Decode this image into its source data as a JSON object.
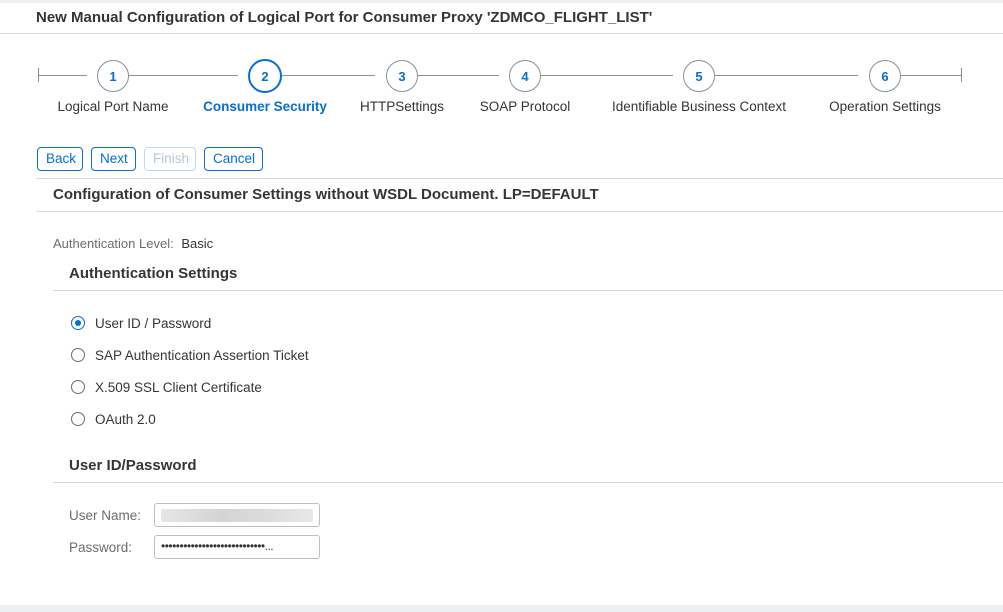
{
  "window": {
    "title": "New Manual Configuration of Logical Port for Consumer Proxy 'ZDMCO_FLIGHT_LIST'"
  },
  "wizard": {
    "active_step": 2,
    "steps": [
      {
        "number": "1",
        "label": "Logical Port Name"
      },
      {
        "number": "2",
        "label": "Consumer Security"
      },
      {
        "number": "3",
        "label": "HTTPSettings"
      },
      {
        "number": "4",
        "label": "SOAP Protocol"
      },
      {
        "number": "5",
        "label": "Identifiable Business Context"
      },
      {
        "number": "6",
        "label": "Operation Settings"
      }
    ]
  },
  "toolbar": {
    "back_label": "Back",
    "next_label": "Next",
    "finish_label": "Finish",
    "cancel_label": "Cancel"
  },
  "section": {
    "title": "Configuration of Consumer Settings without WSDL Document. LP=DEFAULT"
  },
  "auth_level": {
    "label": "Authentication Level:",
    "value": "Basic"
  },
  "auth_settings": {
    "title": "Authentication Settings",
    "selected": "User ID / Password",
    "options": [
      "User ID / Password",
      "SAP Authentication Assertion Ticket",
      "X.509 SSL Client Certificate",
      "OAuth 2.0"
    ]
  },
  "credentials": {
    "title": "User ID/Password",
    "username_label": "User Name:",
    "password_label": "Password:",
    "password_value": "••••••••••••••••••••••••••••..."
  },
  "colors": {
    "accent": "#0a6ed1",
    "text": "#32363a",
    "muted": "#6a6d70",
    "border": "#d9d9d9"
  }
}
